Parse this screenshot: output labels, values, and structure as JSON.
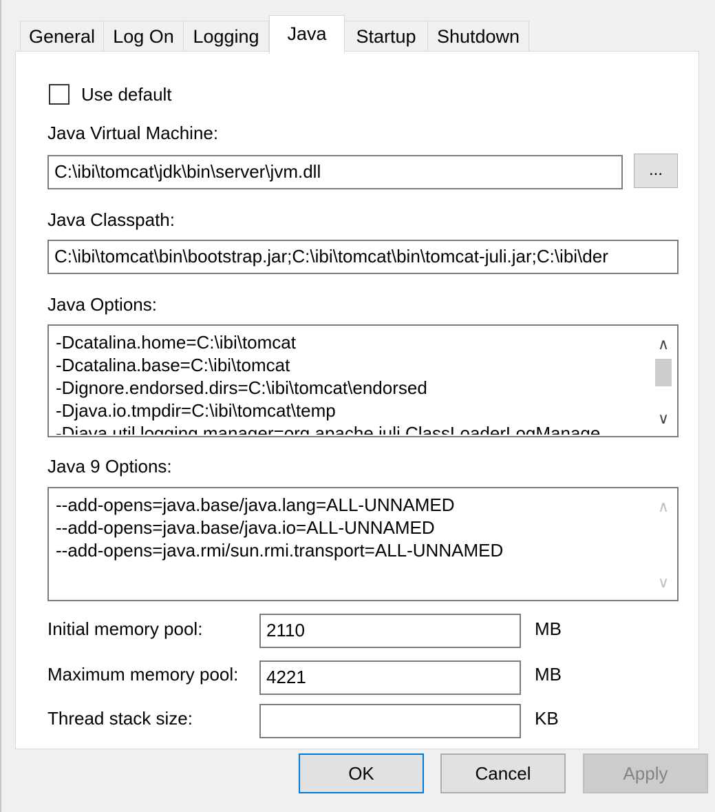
{
  "tabs": [
    {
      "label": "General"
    },
    {
      "label": "Log On"
    },
    {
      "label": "Logging"
    },
    {
      "label": "Java"
    },
    {
      "label": "Startup"
    },
    {
      "label": "Shutdown"
    }
  ],
  "active_tab": "Java",
  "use_default": {
    "label": "Use default",
    "checked": false
  },
  "jvm": {
    "label": "Java Virtual Machine:",
    "value": "C:\\ibi\\tomcat\\jdk\\bin\\server\\jvm.dll",
    "browse_label": "..."
  },
  "classpath": {
    "label": "Java Classpath:",
    "value": "C:\\ibi\\tomcat\\bin\\bootstrap.jar;C:\\ibi\\tomcat\\bin\\tomcat-juli.jar;C:\\ibi\\der"
  },
  "java_options": {
    "label": "Java Options:",
    "lines": [
      "-Dcatalina.home=C:\\ibi\\tomcat",
      "-Dcatalina.base=C:\\ibi\\tomcat",
      "-Dignore.endorsed.dirs=C:\\ibi\\tomcat\\endorsed",
      "-Djava.io.tmpdir=C:\\ibi\\tomcat\\temp",
      "-Djava.util.logging.manager=org.apache.juli.ClassLoaderLogManage"
    ]
  },
  "java9_options": {
    "label": "Java 9 Options:",
    "lines": [
      "--add-opens=java.base/java.lang=ALL-UNNAMED",
      "--add-opens=java.base/java.io=ALL-UNNAMED",
      "--add-opens=java.rmi/sun.rmi.transport=ALL-UNNAMED"
    ]
  },
  "memory": {
    "initial": {
      "label": "Initial memory pool:",
      "value": "2110",
      "unit": "MB"
    },
    "maximum": {
      "label": "Maximum memory pool:",
      "value": "4221",
      "unit": "MB"
    },
    "thread_stack": {
      "label": "Thread stack size:",
      "value": "",
      "unit": "KB"
    }
  },
  "buttons": {
    "ok": "OK",
    "cancel": "Cancel",
    "apply": "Apply"
  },
  "icons": {
    "scroll_up": "chevron-up-icon",
    "scroll_down": "chevron-down-icon"
  }
}
